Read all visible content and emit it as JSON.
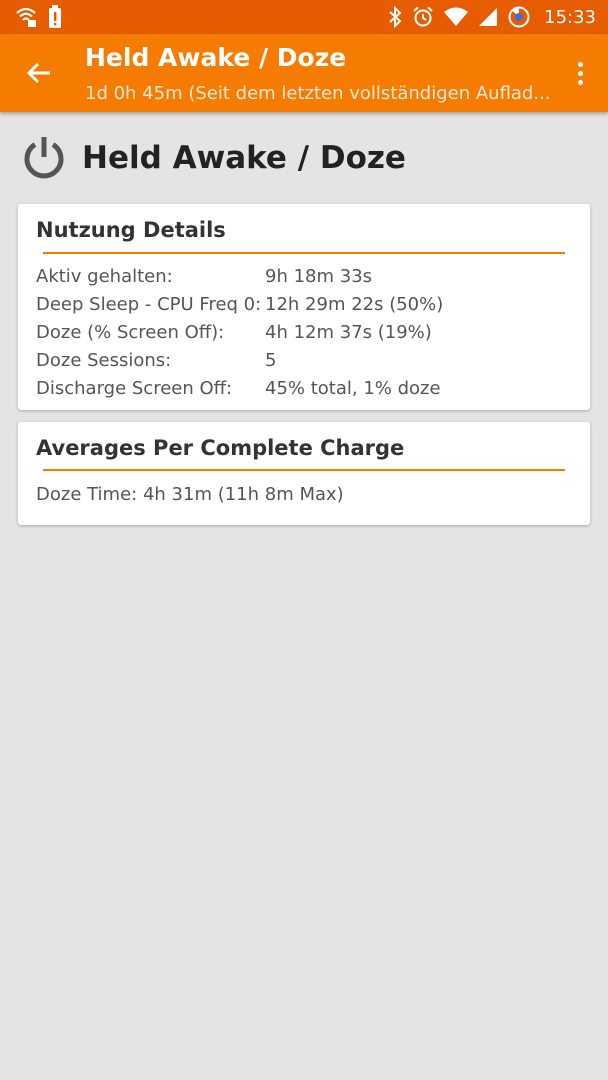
{
  "status_bar": {
    "time": "15:33",
    "icons": [
      "wifi-calling-icon",
      "alert-icon",
      "bluetooth-icon",
      "alarm-icon",
      "wifi-icon",
      "signal-icon",
      "battery-icon"
    ]
  },
  "app_bar": {
    "title": "Held Awake / Doze",
    "subtitle": "1d 0h 45m (Seit dem letzten vollständigen Auflad...",
    "back_icon": "arrow-back-icon",
    "menu_icon": "more-vert-icon"
  },
  "page": {
    "heading": "Held Awake / Doze",
    "heading_icon": "power-icon"
  },
  "usage_card": {
    "title": "Nutzung Details",
    "rows": [
      {
        "label": "Aktiv gehalten:",
        "value": "9h 18m 33s"
      },
      {
        "label": "Deep Sleep - CPU Freq 0:",
        "value": "12h 29m 22s (50%)"
      },
      {
        "label": "Doze (% Screen Off):",
        "value": "4h 12m 37s (19%)"
      },
      {
        "label": "Doze Sessions:",
        "value": "5"
      },
      {
        "label": "Discharge Screen Off:",
        "value": "45% total, 1% doze"
      }
    ]
  },
  "averages_card": {
    "title": "Averages Per Complete Charge",
    "doze_time": "Doze Time:  4h 31m (11h 8m Max)"
  },
  "colors": {
    "status_bar": "#e65c00",
    "app_bar": "#f57c00",
    "accent": "#f57c00",
    "background": "#e4e4e4"
  }
}
